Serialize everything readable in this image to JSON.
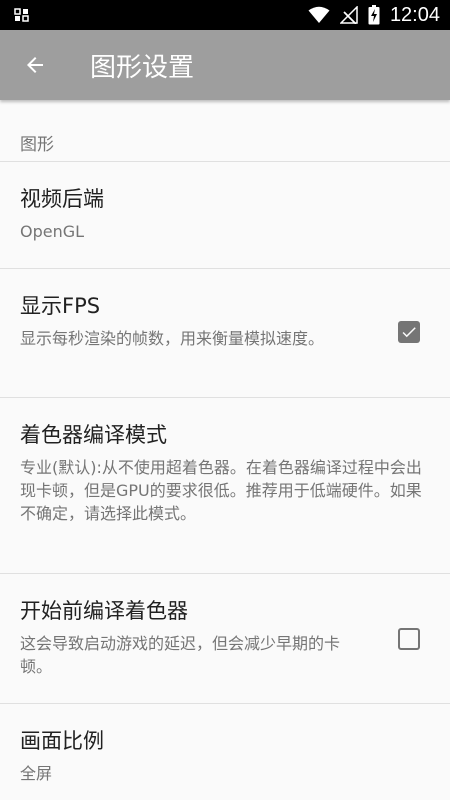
{
  "status_bar": {
    "time": "12:04",
    "icons": [
      "grid-notification-icon",
      "wifi-icon",
      "no-signal-icon",
      "battery-charging-icon"
    ]
  },
  "toolbar": {
    "back_icon": "arrow-back-icon",
    "title": "图形设置"
  },
  "category": {
    "label": "图形"
  },
  "preferences": [
    {
      "title": "视频后端",
      "summary": "OpenGL"
    },
    {
      "title": "显示FPS",
      "summary": "显示每秒渲染的帧数，用来衡量模拟速度。",
      "checked": true
    },
    {
      "title": "着色器编译模式",
      "summary": "专业(默认):从不使用超着色器。在着色器编译过程中会出现卡顿，但是GPU的要求很低。推荐用于低端硬件。如果不确定，请选择此模式。"
    },
    {
      "title": "开始前编译着色器",
      "summary": "这会导致启动游戏的延迟，但会减少早期的卡顿。",
      "checked": false
    },
    {
      "title": "画面比例",
      "summary": "全屏"
    }
  ],
  "colors": {
    "toolbar": "#9e9e9e",
    "status_bar": "#000000",
    "checkbox": "#757575"
  }
}
